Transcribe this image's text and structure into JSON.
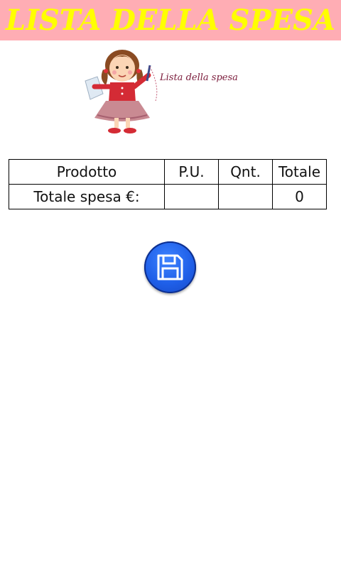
{
  "header": {
    "title": "LISTA DELLA SPESA"
  },
  "illustration": {
    "caption": "Lista della spesa"
  },
  "table": {
    "headers": [
      "Prodotto",
      "P.U.",
      "Qnt.",
      "Totale"
    ],
    "total_row": {
      "label": "Totale spesa €:",
      "unit_price": "",
      "quantity": "",
      "total": "0"
    }
  },
  "save_button": {
    "icon": "floppy-disk-icon"
  },
  "colors": {
    "header_bg": "#ffadb4",
    "title_text": "#ffff00",
    "button_blue": "#1f5fe8"
  }
}
